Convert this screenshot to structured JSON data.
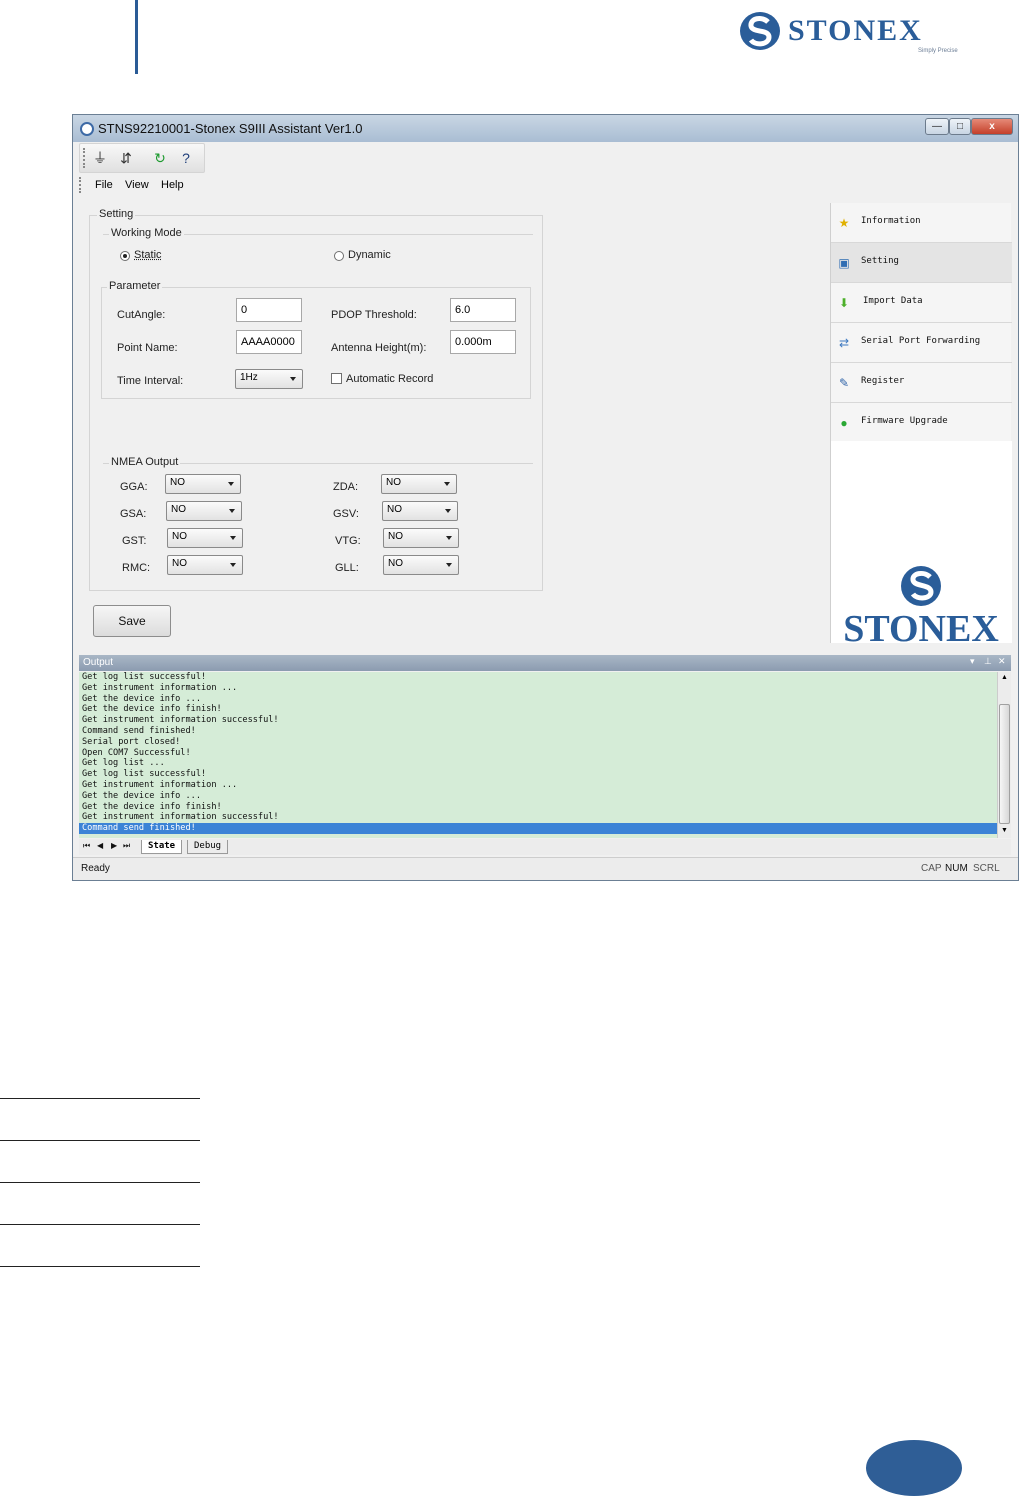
{
  "document": {
    "brand": "STONEX",
    "tagline": "Simply Precise"
  },
  "window": {
    "title": "STNS92210001-Stonex S9III Assistant Ver1.0",
    "controls": {
      "minimize": "—",
      "maximize": "□",
      "close": "x"
    }
  },
  "menu": {
    "file": "File",
    "view": "View",
    "help": "Help"
  },
  "setting": {
    "group_label": "Setting",
    "working_mode": {
      "label": "Working Mode",
      "static": "Static",
      "dynamic": "Dynamic",
      "selected": "Static"
    },
    "parameter": {
      "label": "Parameter",
      "cut_angle_label": "CutAngle:",
      "cut_angle_value": "0",
      "pdop_label": "PDOP Threshold:",
      "pdop_value": "6.0",
      "point_name_label": "Point Name:",
      "point_name_value": "AAAA0000",
      "antenna_height_label": "Antenna Height(m):",
      "antenna_height_value": "0.000m",
      "time_interval_label": "Time Interval:",
      "time_interval_value": "1Hz",
      "auto_record_label": "Automatic Record",
      "auto_record_checked": false
    },
    "nmea": {
      "label": "NMEA Output",
      "rows": [
        {
          "left_label": "GGA:",
          "left_value": "NO",
          "right_label": "ZDA:",
          "right_value": "NO"
        },
        {
          "left_label": "GSA:",
          "left_value": "NO",
          "right_label": "GSV:",
          "right_value": "NO"
        },
        {
          "left_label": "GST:",
          "left_value": "NO",
          "right_label": "VTG:",
          "right_value": "NO"
        },
        {
          "left_label": "RMC:",
          "left_value": "NO",
          "right_label": "GLL:",
          "right_value": "NO"
        }
      ]
    },
    "save_label": "Save"
  },
  "nav": {
    "items": [
      {
        "label": "Information",
        "icon": "star-icon"
      },
      {
        "label": "Setting",
        "icon": "settings-icon"
      },
      {
        "label": "Import Data",
        "icon": "download-arrow-icon"
      },
      {
        "label": "Serial Port Forwarding",
        "icon": "serial-port-icon"
      },
      {
        "label": "Register",
        "icon": "register-icon"
      },
      {
        "label": "Firmware Upgrade",
        "icon": "upgrade-icon"
      }
    ],
    "active": "Setting",
    "logo_text": "STONEX"
  },
  "output": {
    "title": "Output",
    "lines": [
      "Get log list successful!",
      "Get instrument information ...",
      "Get the device info ...",
      "Get the device info finish!",
      "Get instrument information successful!",
      "Command send finished!",
      "Serial port closed!",
      "Open COM7 Successful!",
      "Get log list ...",
      "Get log list successful!",
      "Get instrument information ...",
      "Get the device info ...",
      "Get the device info finish!",
      "Get instrument information successful!",
      "Command send finished!"
    ],
    "tabs": {
      "state": "State",
      "debug": "Debug"
    }
  },
  "status": {
    "text": "Ready",
    "cap": "CAP",
    "num": "NUM",
    "scrl": "SCRL"
  }
}
